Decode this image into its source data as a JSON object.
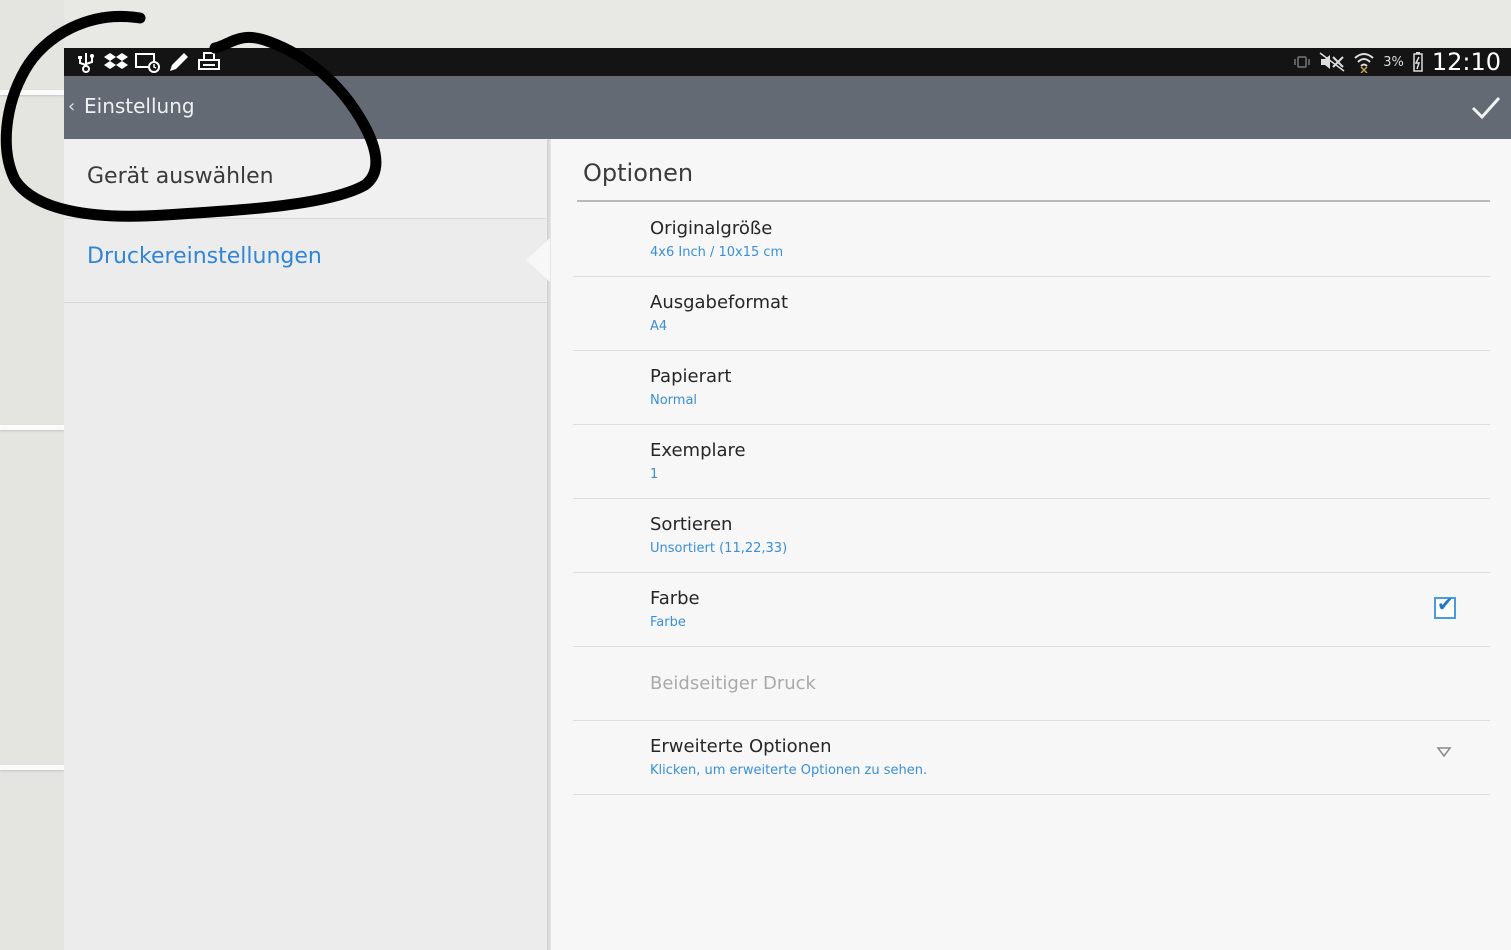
{
  "status_bar": {
    "clock": "12:10",
    "battery_percent": "3%",
    "left_icons": [
      "usb-icon",
      "dropbox-icon",
      "screen-icon",
      "pen-icon",
      "print-icon"
    ],
    "right_icons": [
      "vibrate-icon",
      "mute-icon",
      "wifi-icon",
      "battery-icon"
    ]
  },
  "action_bar": {
    "title": "Einstellung",
    "confirm_icon": "check-icon"
  },
  "left_panel": {
    "items": [
      {
        "label": "Gerät auswählen",
        "selected": false
      },
      {
        "label": "Druckereinstellungen",
        "selected": true
      }
    ]
  },
  "right_panel": {
    "title": "Optionen",
    "options": [
      {
        "title": "Originalgröße",
        "value": "4x6 Inch / 10x15 cm"
      },
      {
        "title": "Ausgabeformat",
        "value": "A4"
      },
      {
        "title": "Papierart",
        "value": "Normal"
      },
      {
        "title": "Exemplare",
        "value": "1"
      },
      {
        "title": "Sortieren",
        "value": "Unsortiert (11,22,33)"
      },
      {
        "title": "Farbe",
        "value": "Farbe",
        "checked": true
      },
      {
        "title": "Beidseitiger Druck",
        "value": "",
        "disabled": true
      },
      {
        "title": "Erweiterte Optionen",
        "value": "Klicken, um erweiterte Optionen zu sehen."
      }
    ]
  },
  "colors": {
    "action_bar": "#646a74",
    "status_bar": "#141414",
    "accent": "#2f86d9",
    "annotation": "#000000"
  }
}
